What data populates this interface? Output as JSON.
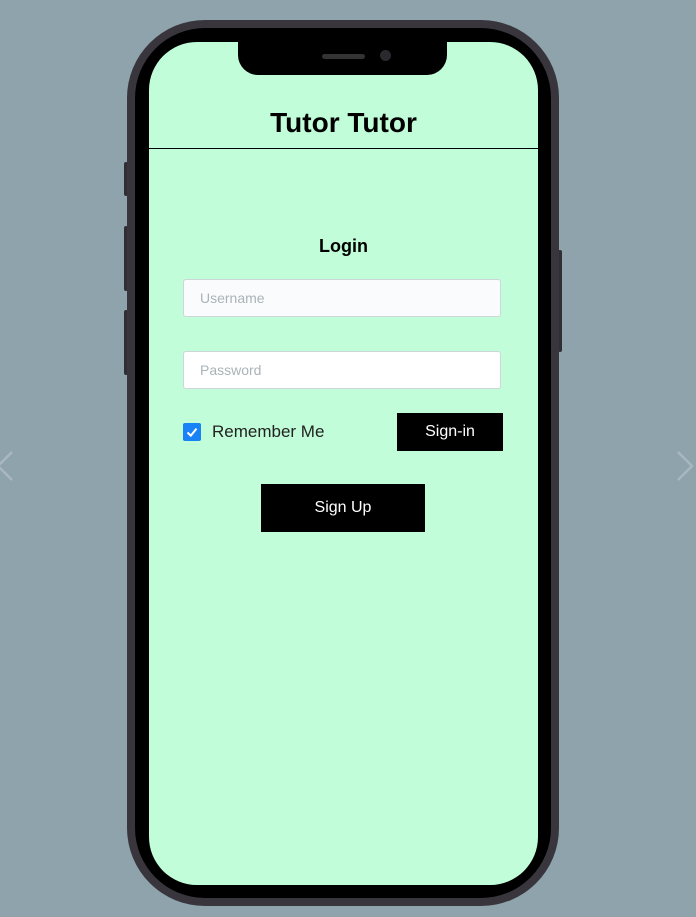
{
  "app": {
    "title": "Tutor Tutor"
  },
  "login": {
    "heading": "Login",
    "username_placeholder": "Username",
    "password_placeholder": "Password",
    "remember_label": "Remember Me",
    "remember_checked": true,
    "signin_label": "Sign-in",
    "signup_label": "Sign Up"
  },
  "icons": {
    "prev": "chevron-left-icon",
    "next": "chevron-right-icon",
    "check": "checkmark-icon"
  },
  "colors": {
    "page_background": "#8fa3ad",
    "screen_background": "#c0fdd8",
    "button_background": "#000000",
    "checkbox_accent": "#1a82f7"
  }
}
